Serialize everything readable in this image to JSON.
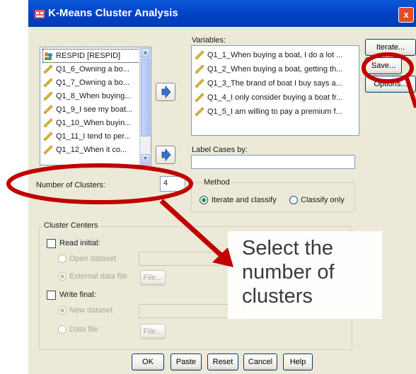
{
  "window": {
    "title": "K-Means Cluster Analysis",
    "close_label": "x"
  },
  "source_list": {
    "items": [
      "RESPID [RESPID]",
      "Q1_6_Owning a bo...",
      "Q1_7_Owning a bo...",
      "Q1_8_When buying...",
      "Q1_9_I see my boat...",
      "Q1_10_When buyin...",
      "Q1_11_I tend to per...",
      "Q1_12_When it co..."
    ]
  },
  "variables": {
    "label": "Variables:",
    "items": [
      "Q1_1_When buying a boat, I do a lot ...",
      "Q1_2_When buying a boat, getting th...",
      "Q1_3_The brand of boat I buy says a...",
      "Q1_4_I only consider buying a boat fr...",
      "Q1_5_I am willing to pay a premium f..."
    ]
  },
  "label_cases": {
    "label": "Label Cases by:",
    "value": ""
  },
  "clusters": {
    "label": "Number of Clusters:",
    "value": "4"
  },
  "method": {
    "legend": "Method",
    "iterate_label": "Iterate and classify",
    "classify_label": "Classify only",
    "selected": "iterate"
  },
  "side_buttons": {
    "iterate": "Iterate...",
    "save": "Save...",
    "options": "Options..."
  },
  "centers": {
    "legend": "Cluster Centers",
    "read_initial": "Read initial:",
    "open_dataset": "Open dataset",
    "external_file": "External data file",
    "write_final": "Write final:",
    "new_dataset": "New dataset",
    "data_file": "Data file",
    "file_button": "File..."
  },
  "bottom_buttons": {
    "ok": "OK",
    "paste": "Paste",
    "reset": "Reset",
    "cancel": "Cancel",
    "help": "Help"
  },
  "annotation": {
    "line1": "Select the",
    "line2": "number of",
    "line3": "clusters"
  },
  "colors": {
    "highlight": "#c00000",
    "accent": "#0a58d8"
  }
}
